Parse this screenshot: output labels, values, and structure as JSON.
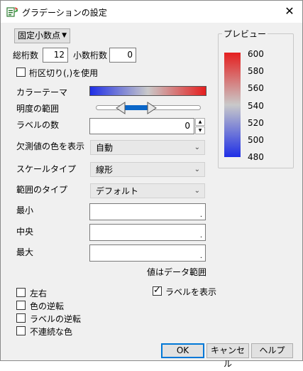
{
  "window": {
    "title": "グラデーションの設定",
    "icon": "gradient-settings-icon",
    "close_glyph": "✕"
  },
  "format_dropdown": {
    "value": "固定小数点",
    "arrow": "▼"
  },
  "total_digits": {
    "label": "総桁数",
    "value": "12"
  },
  "decimal_digits": {
    "label": "小数桁数",
    "value": "0"
  },
  "thousands_separator": {
    "label": "桁区切り(,)を使用",
    "checked": false
  },
  "color_theme": {
    "label": "カラーテーマ",
    "colors": [
      "#1f2fe6",
      "#c9c9c9",
      "#e51f1f"
    ]
  },
  "brightness_range": {
    "label": "明度の範囲"
  },
  "label_count": {
    "label": "ラベルの数",
    "value": "0"
  },
  "missing_color": {
    "label": "欠測値の色を表示",
    "value": "自動"
  },
  "scale_type": {
    "label": "スケールタイプ",
    "value": "線形"
  },
  "range_type": {
    "label": "範囲のタイプ",
    "value": "デフォルト"
  },
  "min": {
    "label": "最小",
    "value": "."
  },
  "center": {
    "label": "中央",
    "value": "."
  },
  "max": {
    "label": "最大",
    "value": "."
  },
  "range_note": "値はデータ範囲",
  "preview": {
    "title": "プレビュー",
    "ticks": [
      "600",
      "580",
      "560",
      "540",
      "520",
      "500",
      "480"
    ],
    "colors": [
      "#e51f1f",
      "#c9c9c9",
      "#1f2fe6"
    ]
  },
  "options_left": [
    {
      "label": "左右",
      "checked": false
    },
    {
      "label": "色の逆転",
      "checked": false
    },
    {
      "label": "ラベルの逆転",
      "checked": false
    },
    {
      "label": "不連続な色",
      "checked": false
    }
  ],
  "show_labels": {
    "label": "ラベルを表示",
    "checked": true
  },
  "buttons": {
    "ok": "OK",
    "cancel": "キャンセル",
    "help": "ヘルプ"
  }
}
